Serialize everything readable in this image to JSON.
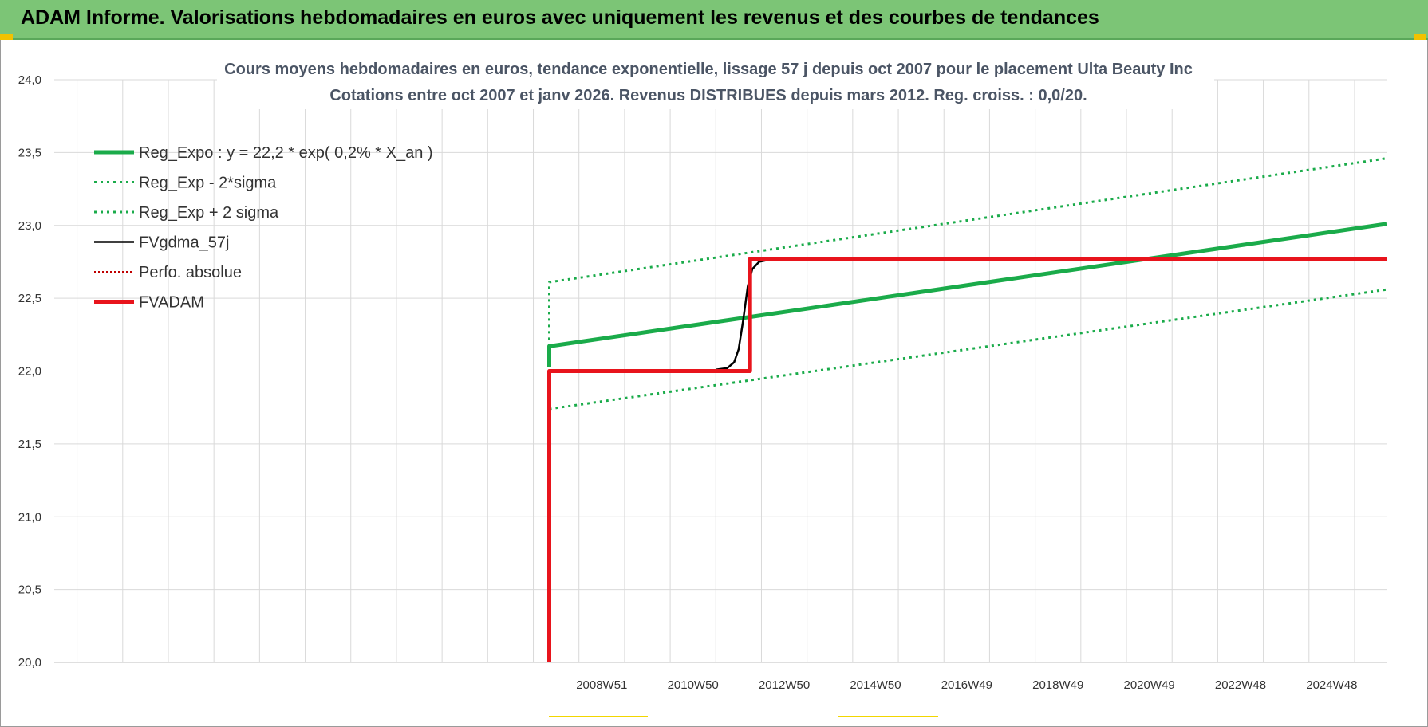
{
  "header": {
    "title": "ADAM Informe. Valorisations hebdomadaires en euros avec uniquement les revenus et des courbes de tendances"
  },
  "colors": {
    "banner": "#7cc576",
    "green": "#1aab4a",
    "red": "#e8141c",
    "black": "#000000",
    "grid": "#d9d9d9"
  },
  "chart_data": {
    "type": "line",
    "title_line1": "Cours moyens hebdomadaires en euros, tendance exponentielle, lissage 57 j depuis oct 2007 pour le placement Ulta Beauty Inc",
    "title_line2": "Cotations entre oct 2007 et janv 2026. Revenus DISTRIBUES depuis mars 2012. Reg. croiss. : 0,0/20.",
    "xlabel": "",
    "ylabel": "",
    "ylim": [
      20.0,
      24.0
    ],
    "xlim": [
      1997.0,
      2026.2
    ],
    "grid": true,
    "legend_position": "top-left",
    "y_ticks": [
      {
        "value": 20.0,
        "label": "20,0"
      },
      {
        "value": 20.5,
        "label": "20,5"
      },
      {
        "value": 21.0,
        "label": "21,0"
      },
      {
        "value": 21.5,
        "label": "21,5"
      },
      {
        "value": 22.0,
        "label": "22,0"
      },
      {
        "value": 22.5,
        "label": "22,5"
      },
      {
        "value": 23.0,
        "label": "23,0"
      },
      {
        "value": 23.5,
        "label": "23,5"
      },
      {
        "value": 24.0,
        "label": "24,0"
      }
    ],
    "x_ticks": [
      {
        "value": 2009.0,
        "label": "2008W51"
      },
      {
        "value": 2011.0,
        "label": "2010W50"
      },
      {
        "value": 2013.0,
        "label": "2012W50"
      },
      {
        "value": 2015.0,
        "label": "2014W50"
      },
      {
        "value": 2017.0,
        "label": "2016W49"
      },
      {
        "value": 2019.0,
        "label": "2018W49"
      },
      {
        "value": 2021.0,
        "label": "2020W49"
      },
      {
        "value": 2023.0,
        "label": "2022W48"
      },
      {
        "value": 2025.0,
        "label": "2024W48"
      }
    ],
    "series": [
      {
        "name": "Reg_Expo : y = 22,2 * exp( 0,2% *  X_an )",
        "color": "#1aab4a",
        "style": "solid-thick",
        "points": [
          [
            2007.85,
            22.03
          ],
          [
            2007.85,
            22.17
          ],
          [
            2026.2,
            23.01
          ]
        ]
      },
      {
        "name": "Reg_Exp - 2*sigma",
        "color": "#1aab4a",
        "style": "dotted",
        "points": [
          [
            2007.85,
            21.74
          ],
          [
            2026.2,
            22.56
          ]
        ]
      },
      {
        "name": "Reg_Exp + 2 sigma",
        "color": "#1aab4a",
        "style": "dotted",
        "points": [
          [
            2007.85,
            22.17
          ],
          [
            2007.85,
            22.61
          ],
          [
            2026.2,
            23.46
          ]
        ]
      },
      {
        "name": "FVgdma_57j",
        "color": "#000000",
        "style": "solid",
        "points": [
          [
            2011.5,
            22.01
          ],
          [
            2011.75,
            22.02
          ],
          [
            2011.9,
            22.06
          ],
          [
            2012.0,
            22.15
          ],
          [
            2012.1,
            22.35
          ],
          [
            2012.2,
            22.58
          ],
          [
            2012.3,
            22.7
          ],
          [
            2012.45,
            22.75
          ],
          [
            2012.6,
            22.76
          ]
        ]
      },
      {
        "name": "Perfo. absolue",
        "color": "#c00000",
        "style": "dotted-thin",
        "points": []
      },
      {
        "name": "FVADAM",
        "color": "#e8141c",
        "style": "solid-thick",
        "points": [
          [
            2007.85,
            20.0
          ],
          [
            2007.85,
            22.0
          ],
          [
            2012.25,
            22.0
          ],
          [
            2012.25,
            22.77
          ],
          [
            2026.2,
            22.77
          ]
        ]
      }
    ]
  }
}
